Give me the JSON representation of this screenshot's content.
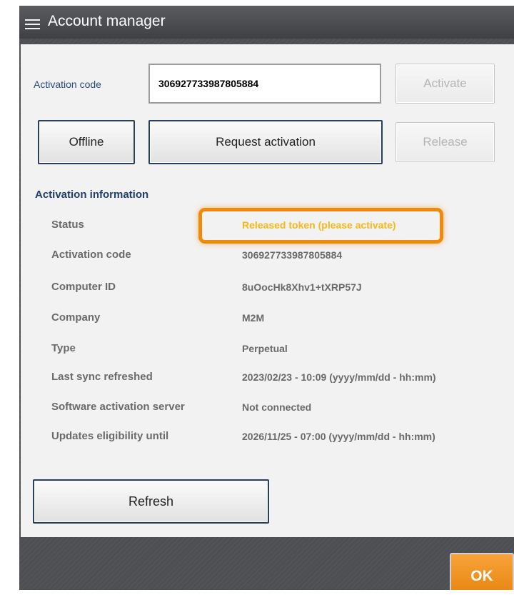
{
  "window": {
    "title": "Account manager",
    "menu_icon": "hamburger-menu-icon"
  },
  "activation": {
    "code_label": "Activation code",
    "code_value": "306927733987805884",
    "activate_label": "Activate",
    "offline_label": "Offline",
    "request_label": "Request activation",
    "release_label": "Release"
  },
  "info": {
    "title": "Activation information",
    "rows": [
      {
        "label": "Status",
        "value": "Released token (please activate)"
      },
      {
        "label": "Activation code",
        "value": "306927733987805884"
      },
      {
        "label": "Computer ID",
        "value": "8uOocHk8Xhv1+tXRP57J"
      },
      {
        "label": "Company",
        "value": "M2M"
      },
      {
        "label": "Type",
        "value": "Perpetual"
      },
      {
        "label": "Last sync refreshed",
        "value": "2023/02/23 - 10:09 (yyyy/mm/dd - hh:mm)"
      },
      {
        "label": "Software activation server",
        "value": "Not connected"
      },
      {
        "label": "Updates eligibility until",
        "value": "2026/11/25 - 07:00 (yyyy/mm/dd - hh:mm)"
      }
    ]
  },
  "footer": {
    "refresh_label": "Refresh",
    "ok_label": "OK"
  },
  "colors": {
    "status_warning": "#f3b81a",
    "highlight": "#f08a0c",
    "ok_button": "#ee8c14",
    "section_title": "#1f3f6e"
  }
}
